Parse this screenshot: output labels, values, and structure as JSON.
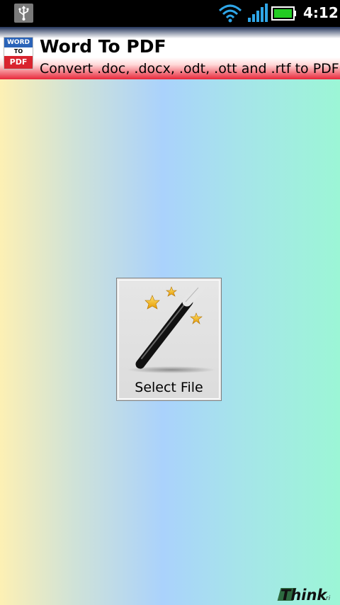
{
  "status_bar": {
    "time": "4:12",
    "icons": [
      "usb-icon",
      "wifi-icon",
      "signal-icon",
      "battery-icon"
    ],
    "battery_color": "#22cc22"
  },
  "header": {
    "logo": {
      "line1": "WORD",
      "line2": "TO",
      "line3": "PDF"
    },
    "title": "Word To PDF",
    "subtitle": "Convert .doc, .docx, .odt, .ott and .rtf to PDF"
  },
  "main": {
    "select_button": {
      "label": "Select File",
      "icon": "magic-wand-icon"
    }
  },
  "footer": {
    "brand": "Think",
    "brand_suffix": "ri"
  }
}
